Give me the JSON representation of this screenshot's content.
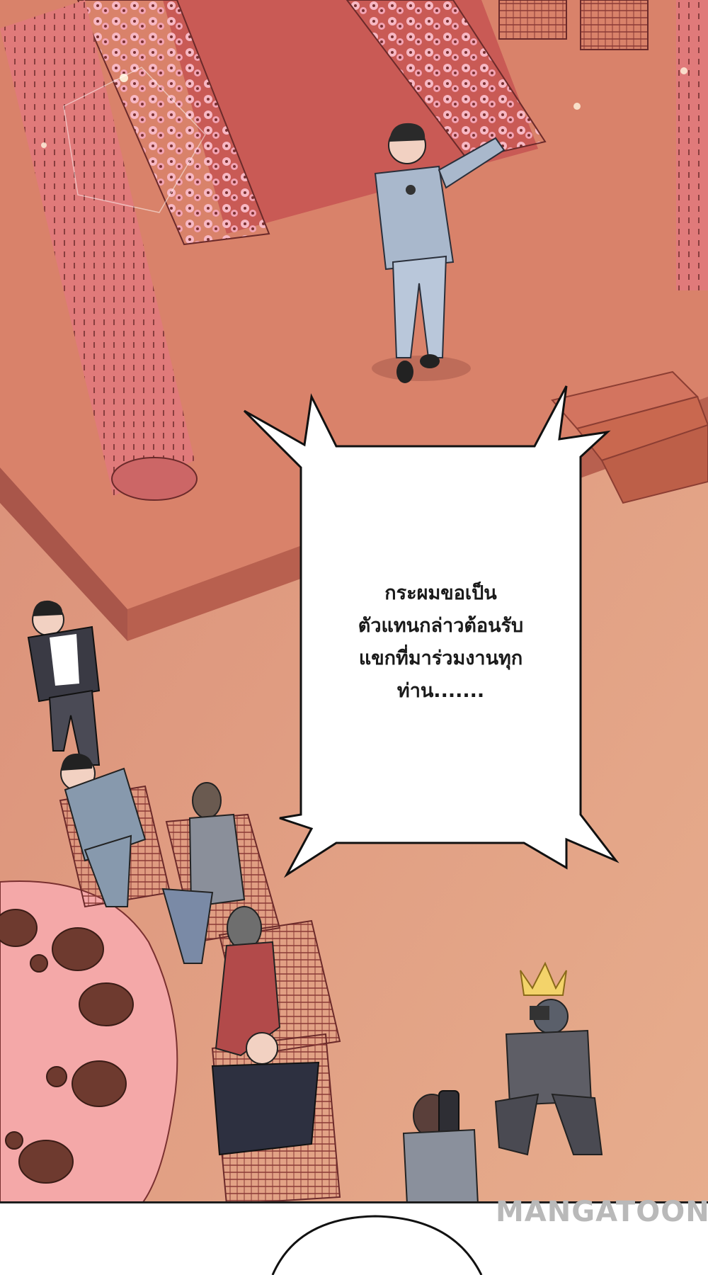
{
  "panel": {
    "speech_bubble": {
      "lines": [
        "กระผมขอเป็น",
        "ตัวแทนกล่าวต้อนรับ",
        "แขกที่มาร่วมงานทุก",
        "ท่าน......."
      ]
    },
    "watermark": "MANGATOON"
  },
  "colors": {
    "stage_floor": "#d9826a",
    "carpet": "#c95a55",
    "pillar": "#e07a7a",
    "table_cloth": "#f4a8a8",
    "ground": "#e2a183",
    "bubble_fill": "#ffffff",
    "bubble_outline": "#111111"
  }
}
